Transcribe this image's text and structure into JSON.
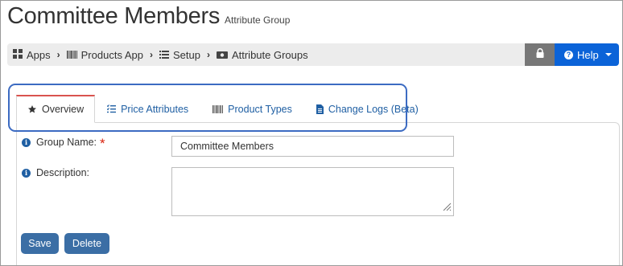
{
  "header": {
    "title": "Committee Members",
    "subtitle": "Attribute Group"
  },
  "breadcrumb": {
    "items": [
      {
        "label": "Apps",
        "icon": "grid-icon"
      },
      {
        "label": "Products App",
        "icon": "barcode-icon"
      },
      {
        "label": "Setup",
        "icon": "list-icon"
      },
      {
        "label": "Attribute Groups",
        "icon": "money-icon"
      }
    ]
  },
  "toolbar": {
    "lock_icon": "lock-icon",
    "help_label": "Help"
  },
  "tabs": [
    {
      "label": "Overview",
      "icon": "star-icon",
      "active": true
    },
    {
      "label": "Price Attributes",
      "icon": "checklist-icon",
      "active": false
    },
    {
      "label": "Product Types",
      "icon": "barcode-icon",
      "active": false
    },
    {
      "label": "Change Logs (Beta)",
      "icon": "file-icon",
      "active": false
    }
  ],
  "form": {
    "group_name_label": "Group Name:",
    "group_name_value": "Committee Members",
    "description_label": "Description:",
    "description_value": "",
    "save_label": "Save",
    "delete_label": "Delete"
  },
  "colors": {
    "help_button": "#0b63d8",
    "lock_button": "#777777",
    "action_button": "#3b6ea5",
    "link": "#1f5fa3",
    "active_tab_top": "#d9534f",
    "tab_highlight": "#3c6bc2",
    "required_star": "#d9230f"
  }
}
